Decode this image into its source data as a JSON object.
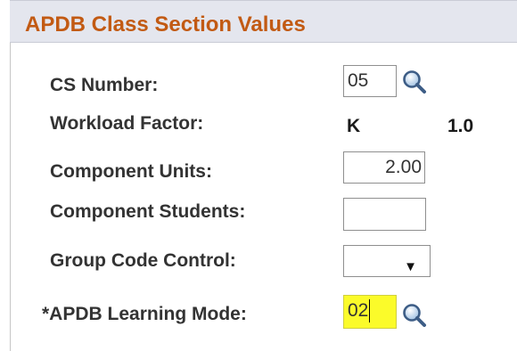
{
  "header": {
    "title": "APDB Class Section Values"
  },
  "fields": {
    "cs_number": {
      "label": "CS Number:",
      "value": "05"
    },
    "workload_factor": {
      "label": "Workload Factor:",
      "code": "K",
      "factor": "1.0"
    },
    "component_units": {
      "label": "Component Units:",
      "value": "2.00"
    },
    "component_students": {
      "label": "Component Students:",
      "value": ""
    },
    "group_code_control": {
      "label": "Group Code Control:",
      "selected": ""
    },
    "learning_mode": {
      "label": "*APDB Learning Mode:",
      "value": "02"
    }
  },
  "icons": {
    "lookup": "magnifying-glass-icon",
    "dropdown": "chevron-down-icon"
  },
  "colors": {
    "title": "#c25a13",
    "header_bg": "#e4e6ee",
    "highlight": "#fbfb2a"
  }
}
